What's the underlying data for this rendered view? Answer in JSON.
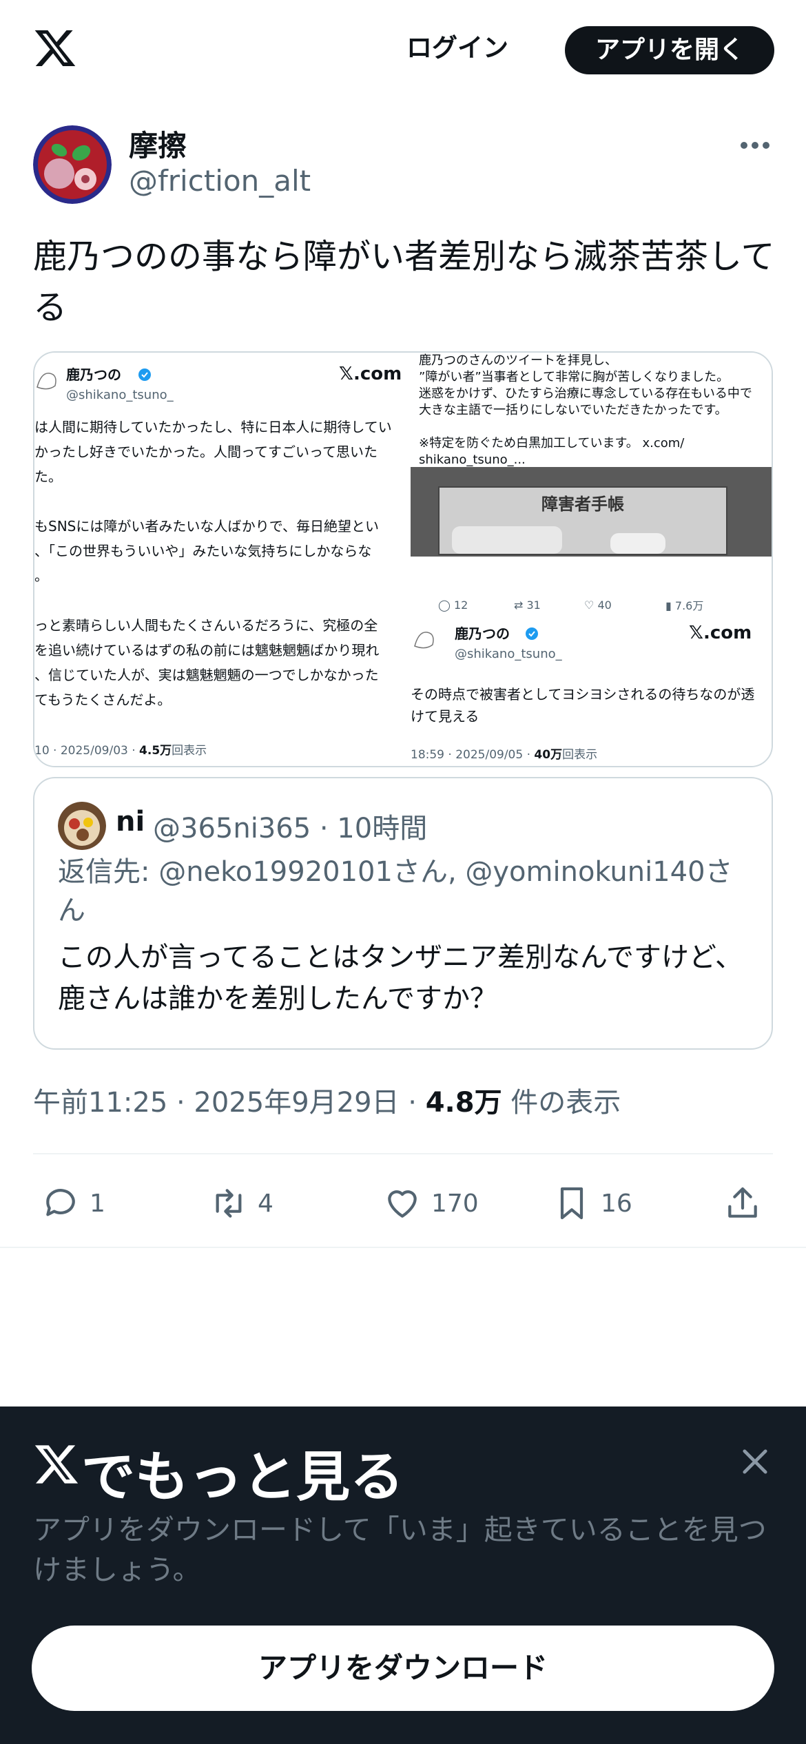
{
  "header": {
    "logo_icon": "x-logo-icon",
    "login_label": "ログイン",
    "open_app_label": "アプリを開く"
  },
  "post": {
    "display_name": "摩擦",
    "handle": "@friction_alt",
    "text": "鹿乃つのの事なら障がい者差別なら滅茶苦茶してる",
    "timestamp": "午前11:25 · 2025年9月29日 ·",
    "views_count": "4.8万",
    "views_label": "件の表示"
  },
  "media": {
    "left": {
      "name": "鹿乃つの",
      "handle": "@shikano_tsuno_",
      "brand": "𝕏.com",
      "lines": [
        "は人間に期待していたかったし、特に日本人に期待してい",
        "かったし好きでいたかった。人間ってすごいって思いた",
        "た。",
        "",
        "もSNSには障がい者みたいな人ばかりで、毎日絶望とい",
        "、「この世界もういいや」みたいな気持ちにしかならな",
        "。",
        "",
        "っと素晴らしい人間もたくさんいるだろうに、究極の全",
        "を追い続けているはずの私の前には魑魅魍魎ばかり現れ",
        "、信じていた人が、実は魑魅魍魎の一つでしかなかった",
        "てもうたくさんだよ。"
      ],
      "footer_time": "10 · 2025/09/03 ·",
      "footer_views": "4.5万",
      "footer_views_label": "回表示"
    },
    "right": {
      "top_lines": [
        "鹿乃つのさんのツイートを拝見し、",
        "”障がい者”当事者として非常に胸が苦しくなりました。",
        "迷惑をかけず、ひたすら治療に専念している存在もいる中で",
        "大きな主語で一括りにしないでいただきたかったです。",
        "",
        "※特定を防ぐため白黒加工しています。 x.com/",
        "shikano_tsuno_..."
      ],
      "photo_caption": "障害者手帳",
      "stats": [
        "12",
        "31",
        "40",
        "7.6万"
      ],
      "name": "鹿乃つの",
      "handle": "@shikano_tsuno_",
      "brand": "𝕏.com",
      "body_lines": [
        "その時点で被害者としてヨシヨシされるの待ちなのが透",
        "けて見える"
      ],
      "footer_time": "18:59 · 2025/09/05 ·",
      "footer_views": "40万",
      "footer_views_label": "回表示"
    }
  },
  "quote": {
    "name": "ni",
    "meta": "@365ni365 · 10時間",
    "reply_to": "返信先: @neko19920101さん, @yominokuni140さん",
    "text": "この人が言ってることはタンザニア差別なんですけど、鹿さんは誰かを差別したんですか？"
  },
  "actions": {
    "reply_count": "1",
    "retweet_count": "4",
    "like_count": "170",
    "bookmark_count": "16"
  },
  "sheet": {
    "title": "でもっと見る",
    "description": "アプリをダウンロードして「いま」起きていることを見つけましょう。",
    "download_label": "アプリをダウンロード"
  },
  "colors": {
    "text": "#0f1419",
    "secondary": "#536471",
    "border": "#cfd9de",
    "sheet_bg": "#141c25"
  }
}
